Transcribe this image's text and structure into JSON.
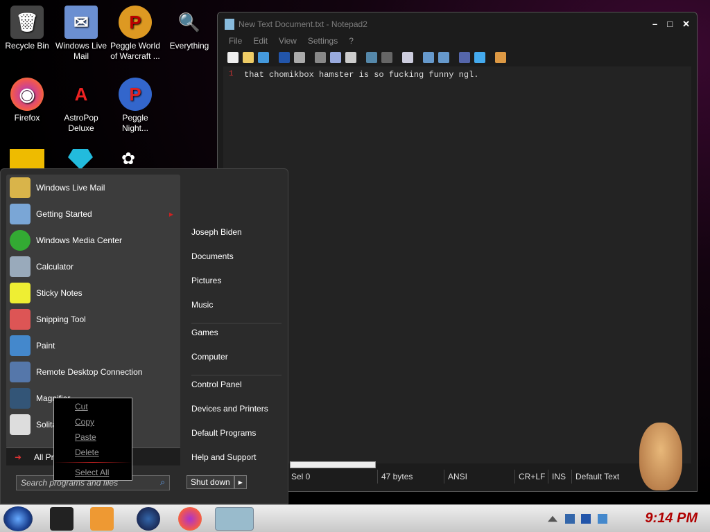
{
  "desktop": {
    "icons": [
      {
        "label": "Recycle Bin",
        "glyph": "🗑",
        "color": "#444"
      },
      {
        "label": "Windows Live Mail",
        "glyph": "✉",
        "color": "#6b8fd1"
      },
      {
        "label": "Peggle World of Warcraft ...",
        "glyph": "P",
        "color": "#d92"
      },
      {
        "label": "Everything",
        "glyph": "🔍",
        "color": "#f80"
      },
      {
        "label": "Firefox",
        "glyph": "◉",
        "color": "#e55"
      },
      {
        "label": "AstroPop Deluxe",
        "glyph": "A",
        "color": "#c22"
      },
      {
        "label": "Peggle Night...",
        "glyph": "P",
        "color": "#36c"
      }
    ]
  },
  "notepad": {
    "title": "New Text Document.txt - Notepad2",
    "menu": [
      "File",
      "Edit",
      "View",
      "Settings",
      "?"
    ],
    "controls": [
      "–",
      "□",
      "✕"
    ],
    "line_no": "1",
    "text": "that chomikbox hamster is so fucking funny ngl.",
    "status": [
      "Sel 0",
      "47 bytes",
      "ANSI",
      "CR+LF",
      "INS",
      "Default Text"
    ]
  },
  "start": {
    "programs": [
      {
        "label": "Windows Live Mail",
        "color": "#d9b44a"
      },
      {
        "label": "Getting Started",
        "color": "#7aa6d6"
      },
      {
        "label": "Windows Media Center",
        "color": "#3a3"
      },
      {
        "label": "Calculator",
        "color": "#9ab"
      },
      {
        "label": "Sticky Notes",
        "color": "#ee3"
      },
      {
        "label": "Snipping Tool",
        "color": "#d55"
      },
      {
        "label": "Paint",
        "color": "#48c"
      },
      {
        "label": "Remote Desktop Connection",
        "color": "#57a"
      },
      {
        "label": "Magnifier",
        "color": "#357"
      },
      {
        "label": "Solitaire",
        "color": "#ddd"
      }
    ],
    "all_programs": "All Programs",
    "search_placeholder": "Search programs and files",
    "right": [
      "Joseph Biden",
      "Documents",
      "Pictures",
      "Music",
      "Games",
      "Computer",
      "Control Panel",
      "Devices and Printers",
      "Default Programs",
      "Help and Support"
    ],
    "shutdown": "Shut down",
    "shut_arrow": "▸"
  },
  "context_menu": [
    "Cut",
    "Copy",
    "Paste",
    "Delete",
    "Select All"
  ],
  "taskbar": {
    "clock": "9:14 PM"
  }
}
